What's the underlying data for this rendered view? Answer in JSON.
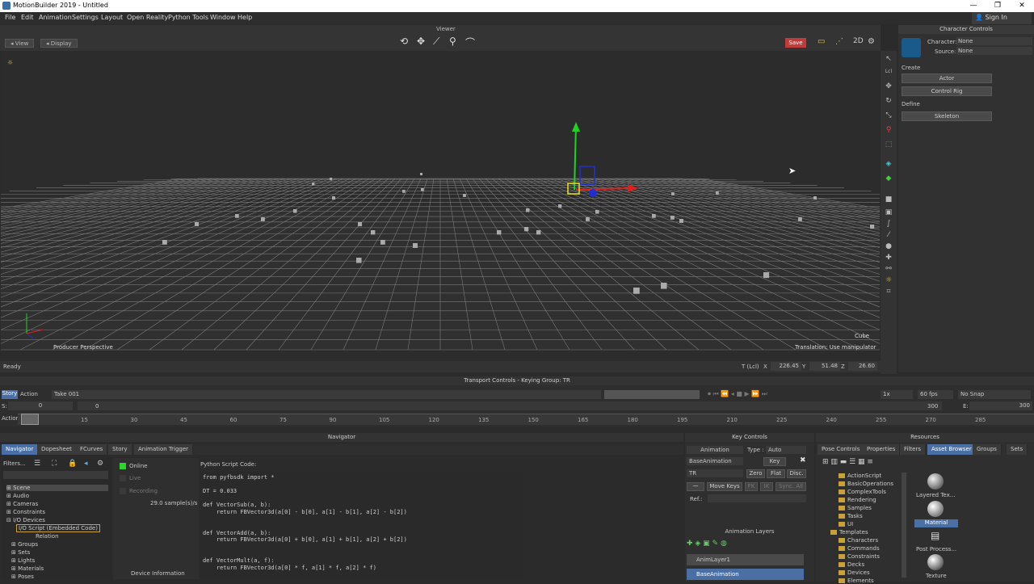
{
  "window": {
    "title": "MotionBuilder 2019 - Untitled",
    "min": "—",
    "max": "❐",
    "close": "✕"
  },
  "menu": [
    "File",
    "Edit",
    "Animation",
    "Settings",
    "Layout",
    "Open Reality",
    "Python Tools",
    "Window",
    "Help"
  ],
  "signin": "Sign In",
  "viewer": {
    "header": "Viewer",
    "view_btn": "View",
    "display_btn": "Display",
    "save_btn": "Save",
    "camera_label": "Producer Perspective",
    "selection_label": "Cube",
    "hint": "Translation: Use manipulator",
    "status": "Ready",
    "coords": {
      "mode": "T (Lcl)",
      "x_label": "X",
      "x": "226.45",
      "y_label": "Y",
      "y": "51.48",
      "z_label": "Z",
      "z": "26.60"
    }
  },
  "character_controls": {
    "header": "Character Controls",
    "character_label": "Character:",
    "character_value": "None",
    "source_label": "Source:",
    "source_value": "None",
    "create_label": "Create",
    "actor_btn": "Actor",
    "control_rig_btn": "Control Rig",
    "define_label": "Define",
    "skeleton_btn": "Skeleton"
  },
  "transport": {
    "header": "Transport Controls  -  Keying Group: TR",
    "story_tab": "Story",
    "action_tab": "Action",
    "take": "Take 001",
    "speed": "1x",
    "fps": "60 fps",
    "snap": "No Snap",
    "start_label": "S:",
    "start": "0",
    "frame": "0",
    "end": "300",
    "end_label": "E:",
    "end2": "300",
    "action_label": "Action",
    "ticks": [
      "15",
      "30",
      "45",
      "60",
      "75",
      "90",
      "105",
      "120",
      "135",
      "150",
      "165",
      "180",
      "195",
      "210",
      "225",
      "240",
      "255",
      "270",
      "285"
    ]
  },
  "navigator": {
    "header": "Navigator",
    "tabs": [
      "Navigator",
      "Dopesheet",
      "FCurves",
      "Story",
      "Animation Trigger"
    ],
    "filters": "Filters...",
    "tree": [
      "Scene",
      "Audio",
      "Cameras",
      "Constraints",
      "I/O Devices",
      "I/O Script (Embedded Code)",
      "Relation",
      "Groups",
      "Sets",
      "Lights",
      "Materials",
      "Poses"
    ],
    "online": "Online",
    "live": "Live",
    "recording": "Recording",
    "sample_rate": "29.0 sample(s)/s",
    "device_info": "Device Information",
    "code_label": "Python Script Code:",
    "code": "from pyfbsdk import *\n\nDT = 0.033\n\ndef VectorSub(a, b):\n    return FBVector3d(a[0] - b[0], a[1] - b[1], a[2] - b[2])\n\n\ndef VectorAdd(a, b):\n    return FBVector3d(a[0] + b[0], a[1] + b[1], a[2] + b[2])\n\n\ndef VectorMult(a, f):\n    return FBVector3d(a[0] * f, a[1] * f, a[2] * f)"
  },
  "key_controls": {
    "header": "Key Controls",
    "animation": "Animation",
    "type_label": "Type :",
    "type_value": "Auto",
    "base_animation": "BaseAnimation",
    "key_btn": "Key",
    "tr": "TR",
    "zero_btn": "Zero",
    "flat_btn": "Flat",
    "disc_btn": "Disc.",
    "move_keys": "Move Keys",
    "fk": "FK",
    "ik": "IK",
    "sync": "Sync. All",
    "ref_label": "Ref.:",
    "layers_header": "Animation Layers",
    "layer1": "AnimLayer1",
    "layer2": "BaseAnimation"
  },
  "resources": {
    "header": "Resources",
    "tabs": [
      "Pose Controls",
      "Properties",
      "Filters",
      "Asset Browser",
      "Groups",
      "Sets"
    ],
    "tree": [
      "ActionScript",
      "BasicOperations",
      "ComplexTools",
      "Rendering",
      "Samples",
      "Tasks",
      "UI",
      "Templates",
      "Characters",
      "Commands",
      "Constraints",
      "Decks",
      "Devices",
      "Elements"
    ],
    "assets": [
      "Layered Tex...",
      "Material",
      "Post Process...",
      "Texture"
    ]
  }
}
